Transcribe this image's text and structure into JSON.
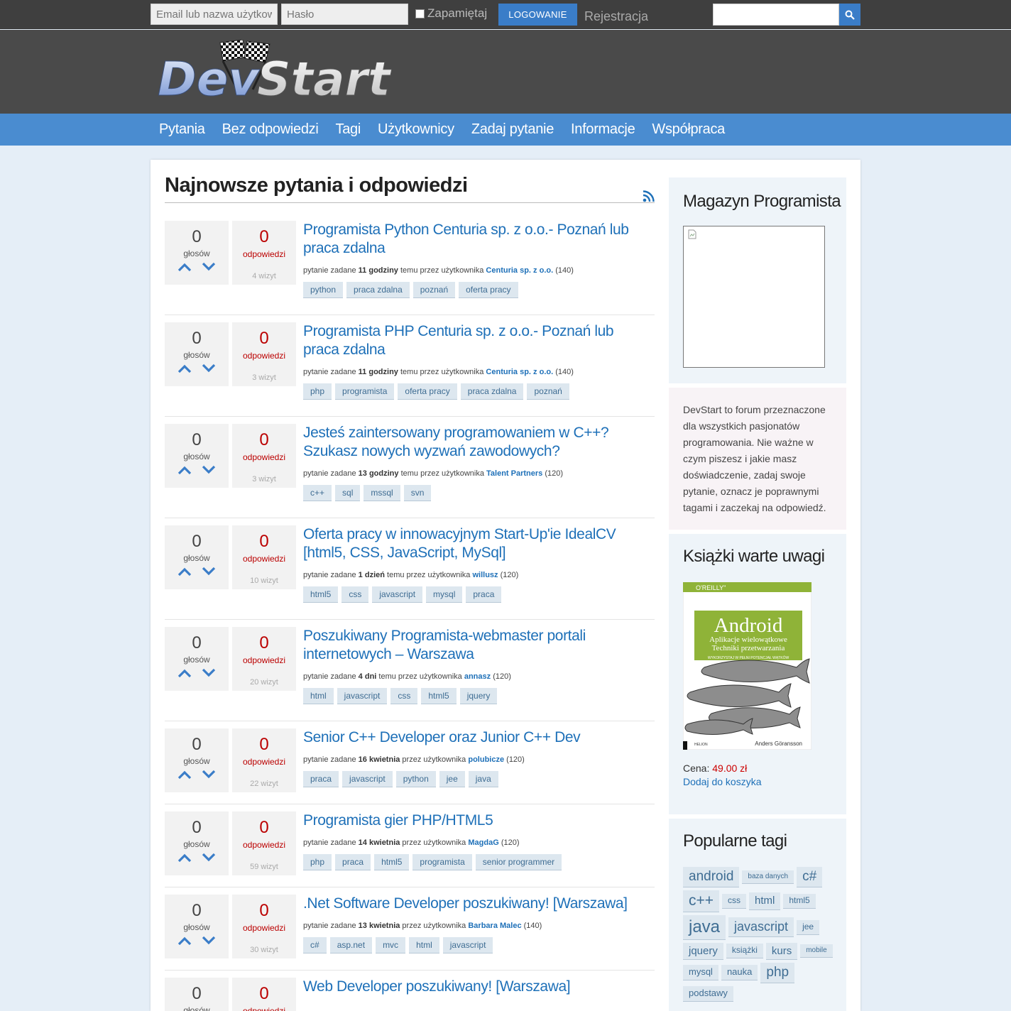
{
  "topbar": {
    "email_placeholder": "Email lub nazwa użytkownika",
    "password_placeholder": "Hasło",
    "remember_label": "Zapamiętaj",
    "login_label": "LOGOWANIE",
    "register_label": "Rejestracja"
  },
  "logo": {
    "text": "DevStart"
  },
  "nav": [
    "Pytania",
    "Bez odpowiedzi",
    "Tagi",
    "Użytkownicy",
    "Zadaj pytanie",
    "Informacje",
    "Współpraca"
  ],
  "main": {
    "title": "Najnowsze pytania i odpowiedzi",
    "votes_label": "głosów",
    "answers_label": "odpowiedzi",
    "questions": [
      {
        "votes": "0",
        "answers": "0",
        "views": "4 wizyt",
        "title": "Programista Python Centuria sp. z o.o.- Poznań lub praca zdalna",
        "meta_pre": "pytanie zadane ",
        "when": "11 godziny",
        "meta_mid": " temu przez użytkownika ",
        "user": "Centuria sp. z o.o.",
        "points": " (140)",
        "tags": [
          "python",
          "praca zdalna",
          "poznań",
          "oferta pracy"
        ]
      },
      {
        "votes": "0",
        "answers": "0",
        "views": "3 wizyt",
        "title": "Programista PHP Centuria sp. z o.o.- Poznań lub praca zdalna",
        "meta_pre": "pytanie zadane ",
        "when": "11 godziny",
        "meta_mid": " temu przez użytkownika ",
        "user": "Centuria sp. z o.o.",
        "points": " (140)",
        "tags": [
          "php",
          "programista",
          "oferta pracy",
          "praca zdalna",
          "poznań"
        ]
      },
      {
        "votes": "0",
        "answers": "0",
        "views": "3 wizyt",
        "title": "Jesteś zaintersowany programowaniem w C++? Szukasz nowych wyzwań zawodowych?",
        "meta_pre": "pytanie zadane ",
        "when": "13 godziny",
        "meta_mid": " temu przez użytkownika ",
        "user": "Talent Partners",
        "points": " (120)",
        "tags": [
          "c++",
          "sql",
          "mssql",
          "svn"
        ]
      },
      {
        "votes": "0",
        "answers": "0",
        "views": "10 wizyt",
        "title": "Oferta pracy w innowacyjnym Start-Up'ie IdealCV [html5, CSS, JavaScript, MySql]",
        "meta_pre": "pytanie zadane ",
        "when": "1 dzień",
        "meta_mid": " temu przez użytkownika ",
        "user": "willusz",
        "points": " (120)",
        "tags": [
          "html5",
          "css",
          "javascript",
          "mysql",
          "praca"
        ]
      },
      {
        "votes": "0",
        "answers": "0",
        "views": "20 wizyt",
        "title": "Poszukiwany Programista-webmaster portali internetowych – Warszawa",
        "meta_pre": "pytanie zadane ",
        "when": "4 dni",
        "meta_mid": " temu przez użytkownika ",
        "user": "annasz",
        "points": " (120)",
        "tags": [
          "html",
          "javascript",
          "css",
          "html5",
          "jquery"
        ]
      },
      {
        "votes": "0",
        "answers": "0",
        "views": "22 wizyt",
        "title": "Senior C++ Developer oraz Junior C++ Dev",
        "meta_pre": "pytanie zadane ",
        "when": "16 kwietnia",
        "meta_mid": " przez użytkownika ",
        "user": "polubicze",
        "points": " (120)",
        "tags": [
          "praca",
          "javascript",
          "python",
          "jee",
          "java"
        ]
      },
      {
        "votes": "0",
        "answers": "0",
        "views": "59 wizyt",
        "title": "Programista gier PHP/HTML5",
        "meta_pre": "pytanie zadane ",
        "when": "14 kwietnia",
        "meta_mid": " przez użytkownika ",
        "user": "MagdaG",
        "points": " (120)",
        "tags": [
          "php",
          "praca",
          "html5",
          "programista",
          "senior programmer"
        ]
      },
      {
        "votes": "0",
        "answers": "0",
        "views": "30 wizyt",
        "title": ".Net Software Developer poszukiwany! [Warszawa]",
        "meta_pre": "pytanie zadane ",
        "when": "13 kwietnia",
        "meta_mid": " przez użytkownika ",
        "user": "Barbara Malec",
        "points": " (140)",
        "tags": [
          "c#",
          "asp.net",
          "mvc",
          "html",
          "javascript"
        ]
      },
      {
        "votes": "0",
        "answers": "0",
        "views": "",
        "title": "Web Developer poszukiwany! [Warszawa]",
        "meta_pre": "",
        "when": "",
        "meta_mid": "",
        "user": "",
        "points": "",
        "tags": []
      }
    ]
  },
  "sidebar": {
    "magazine_title": "Magazyn Programista",
    "about_text": "DevStart to forum przeznaczone dla wszystkich pasjonatów programowania. Nie ważne w czym piszesz i jakie masz doświadczenie, zadaj swoje pytanie, oznacz je poprawnymi tagami i zaczekaj na odpowiedź.",
    "books_title": "Książki warte uwagi",
    "book": {
      "publisher": "O'REILLY\"",
      "title": "Android",
      "subtitle1": "Aplikacje wielowątkowe",
      "subtitle2": "Techniki przetwarzania",
      "tagline": "WYKORZYSTAJ W PEŁNI POTENCJAŁ WĄTKÓW",
      "author": "Anders Göransson",
      "imprint": "HELION"
    },
    "price_label": "Cena: ",
    "price_value": "49.00 zł",
    "cart_label": "Dodaj do koszyka",
    "tags_title": "Popularne tagi",
    "popular_tags": [
      {
        "name": "android",
        "size": 19
      },
      {
        "name": "baza danych",
        "size": 10
      },
      {
        "name": "c#",
        "size": 19
      },
      {
        "name": "c++",
        "size": 21
      },
      {
        "name": "css",
        "size": 12
      },
      {
        "name": "html",
        "size": 15
      },
      {
        "name": "html5",
        "size": 12
      },
      {
        "name": "java",
        "size": 24
      },
      {
        "name": "javascript",
        "size": 18
      },
      {
        "name": "jee",
        "size": 12
      },
      {
        "name": "jquery",
        "size": 15
      },
      {
        "name": "książki",
        "size": 12
      },
      {
        "name": "kurs",
        "size": 15
      },
      {
        "name": "mobile",
        "size": 10
      },
      {
        "name": "mysql",
        "size": 13
      },
      {
        "name": "nauka",
        "size": 13
      },
      {
        "name": "php",
        "size": 19
      },
      {
        "name": "podstawy",
        "size": 13
      }
    ]
  },
  "colors": {
    "accent": "#3a7dc8",
    "nav": "#4a8cd0",
    "link": "#1e70b8",
    "answers": "#bb0000"
  }
}
